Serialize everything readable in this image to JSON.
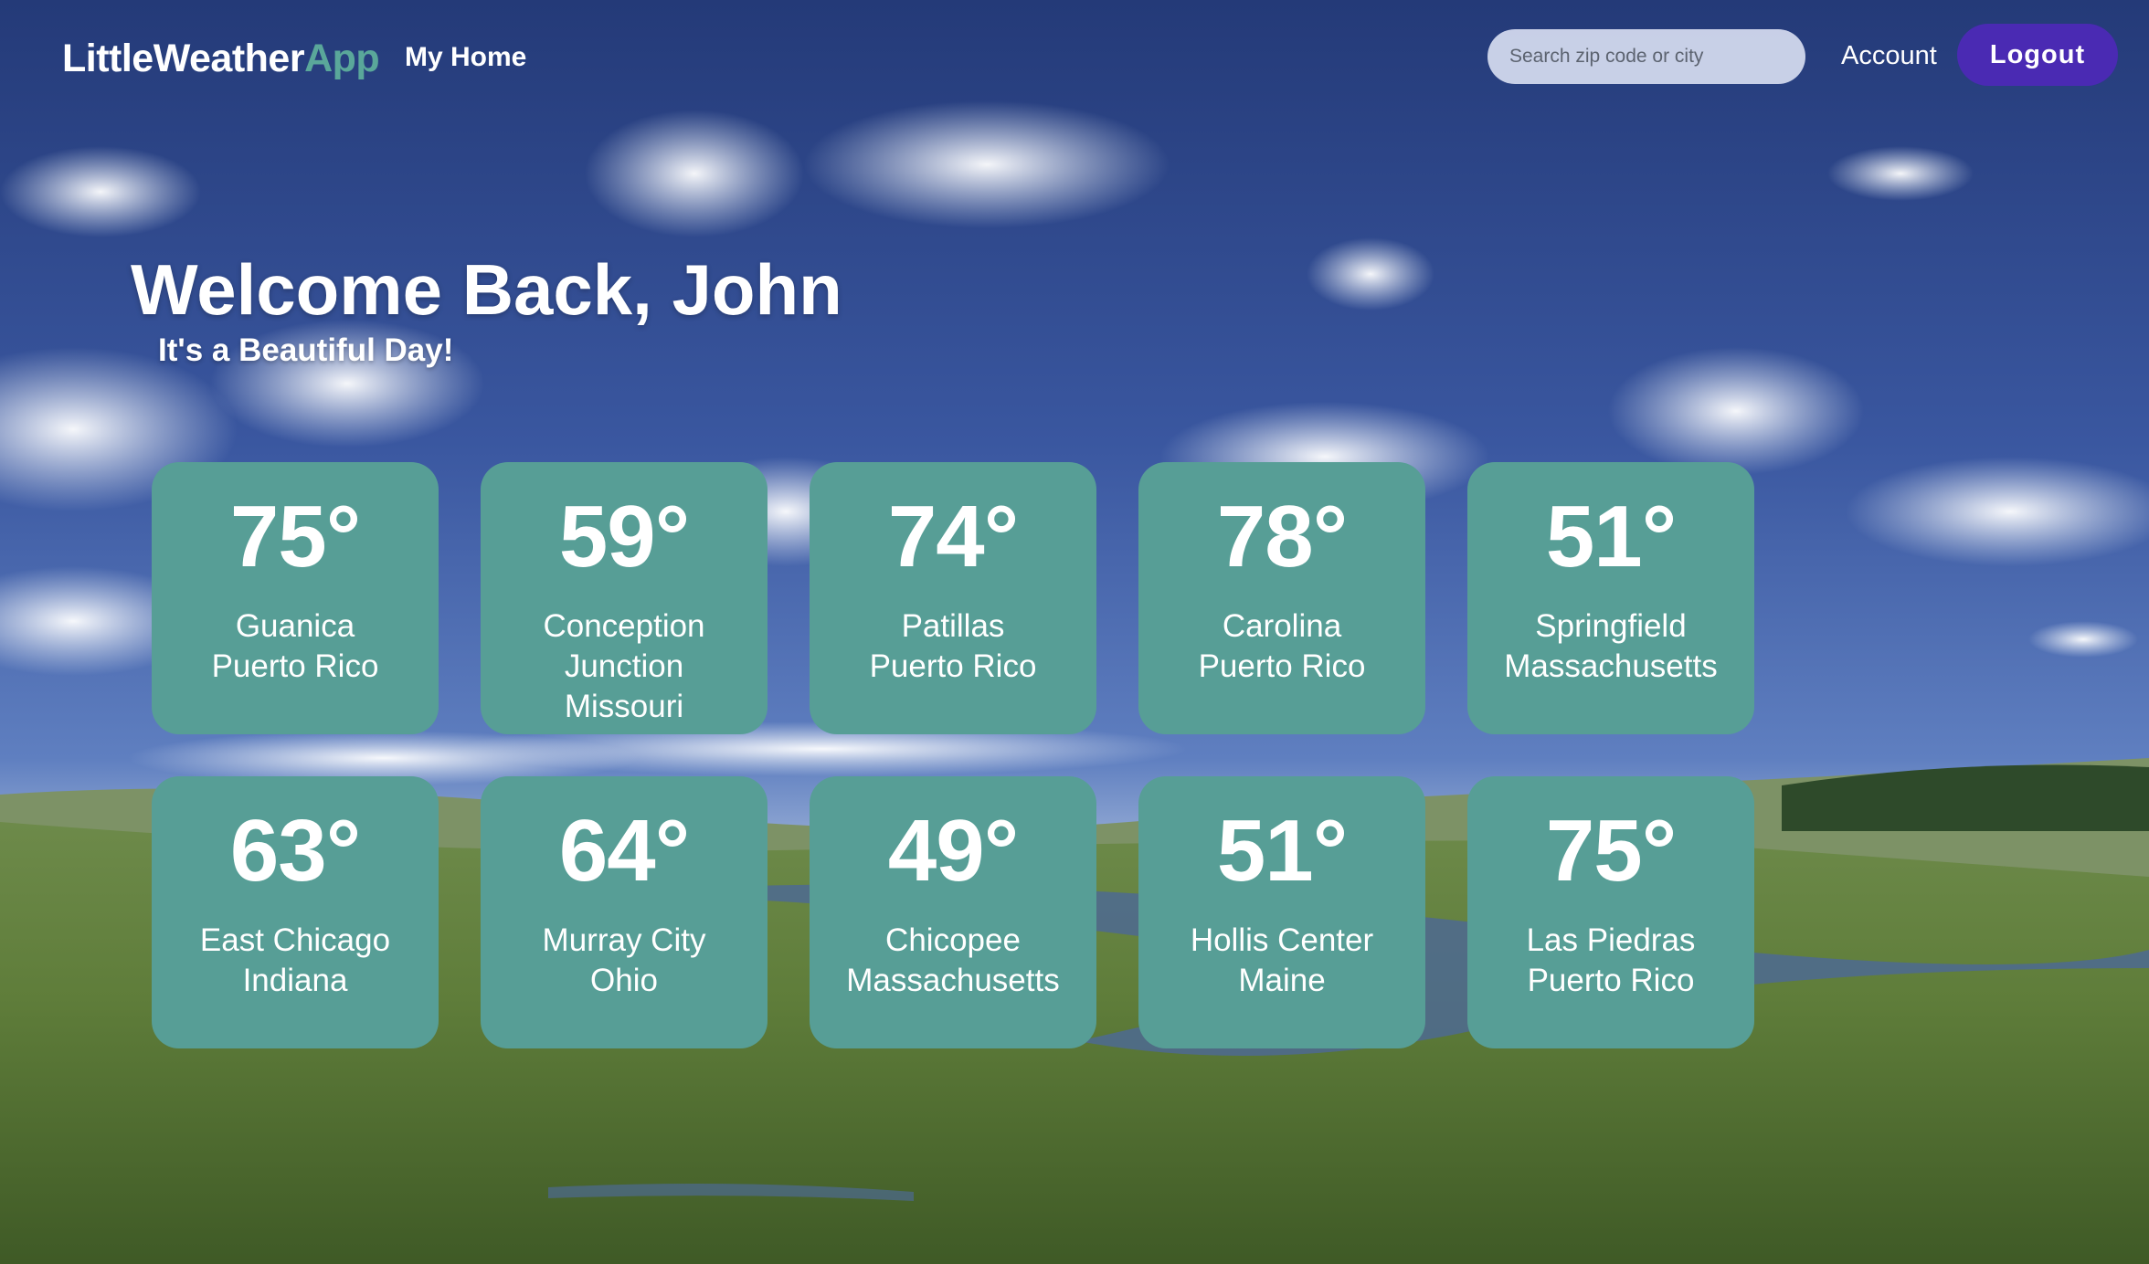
{
  "brand": {
    "name_main": "LittleWeather",
    "name_accent": "App"
  },
  "nav": {
    "home_label": "My Home",
    "search_placeholder": "Search zip code or city",
    "account_label": "Account",
    "logout_label": "Logout"
  },
  "welcome": {
    "title": "Welcome Back, John",
    "subtitle": "It's a Beautiful Day!"
  },
  "cards": [
    {
      "temp": "75°",
      "city": "Guanica",
      "region": "Puerto Rico"
    },
    {
      "temp": "59°",
      "city": "Conception Junction",
      "region": "Missouri"
    },
    {
      "temp": "74°",
      "city": "Patillas",
      "region": "Puerto Rico"
    },
    {
      "temp": "78°",
      "city": "Carolina",
      "region": "Puerto Rico"
    },
    {
      "temp": "51°",
      "city": "Springfield",
      "region": "Massachusetts"
    },
    {
      "temp": "63°",
      "city": "East Chicago",
      "region": "Indiana"
    },
    {
      "temp": "64°",
      "city": "Murray City",
      "region": "Ohio"
    },
    {
      "temp": "49°",
      "city": "Chicopee",
      "region": "Massachusetts"
    },
    {
      "temp": "51°",
      "city": "Hollis Center",
      "region": "Maine"
    },
    {
      "temp": "75°",
      "city": "Las Piedras",
      "region": "Puerto Rico"
    }
  ],
  "colors": {
    "card": "#579e96",
    "logout": "#4a2ab3",
    "brand_accent": "#5aa79a",
    "sky_top": "#243a78",
    "grass": "#5f7d3a"
  }
}
